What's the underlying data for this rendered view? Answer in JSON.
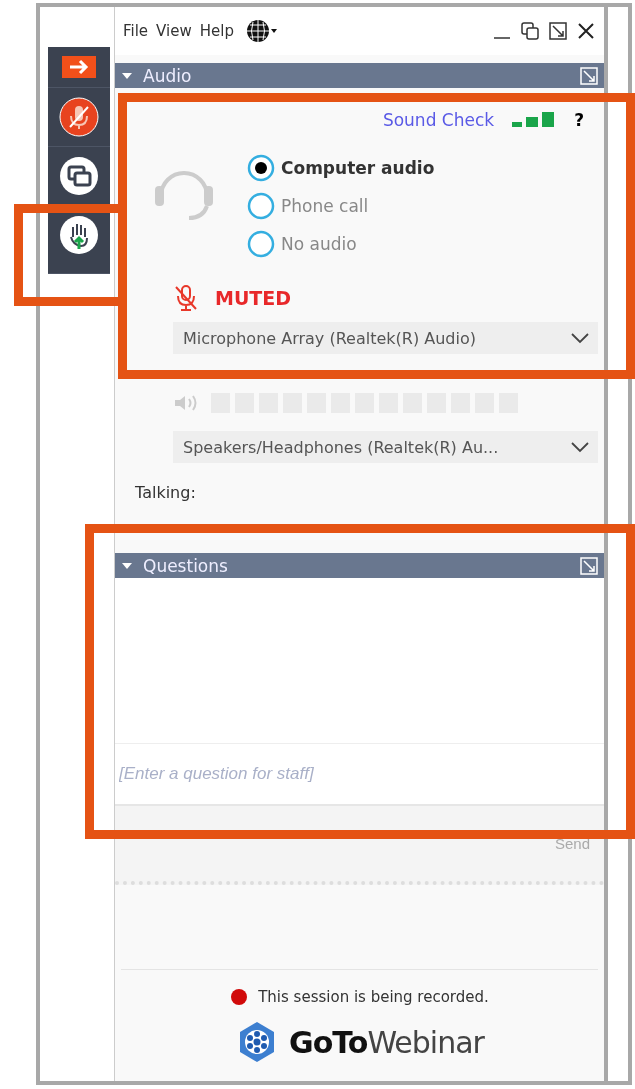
{
  "menu": [
    {
      "label": "File"
    },
    {
      "label": "View"
    },
    {
      "label": "Help"
    }
  ],
  "sidebar": [
    {
      "kind": "arrow"
    },
    {
      "kind": "mic"
    },
    {
      "kind": "screen"
    },
    {
      "kind": "hand"
    }
  ],
  "audio": {
    "title": "Audio",
    "expanded": true,
    "sound_check": "Sound Check",
    "help": "?",
    "options": [
      {
        "label": "Computer audio",
        "selected": true
      },
      {
        "label": "Phone call",
        "selected": false
      },
      {
        "label": "No audio",
        "selected": false
      }
    ],
    "mic_status": "MUTED",
    "microphone": "Microphone Array (Realtek(R) Audio)",
    "speaker": "Speakers/Headphones  (Realtek(R)  Au...",
    "talking": "Talking:"
  },
  "questions": {
    "title": "Questions",
    "expanded": true,
    "placeholder": "[Enter a question for staff]",
    "send": "Send"
  },
  "footer": {
    "recording": "This session is being recorded.",
    "logo": "**GoTo**Webinar"
  }
}
